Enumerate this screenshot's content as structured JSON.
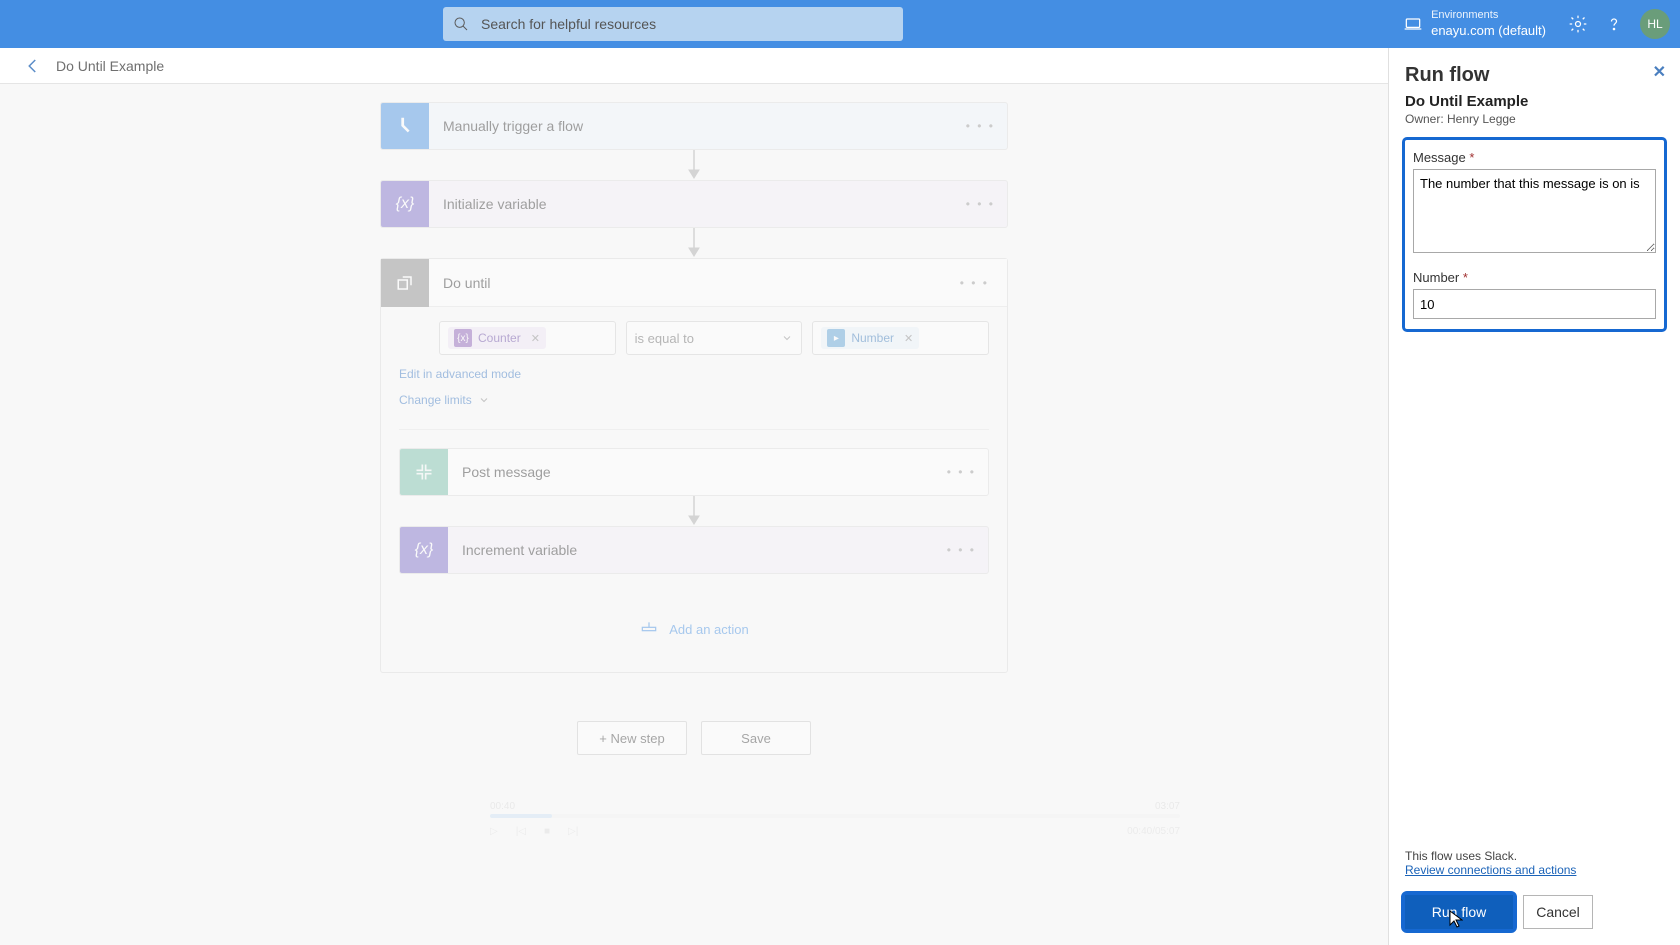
{
  "topbar": {
    "search_placeholder": "Search for helpful resources",
    "env_label": "Environments",
    "env_name": "enayu.com (default)",
    "avatar_initials": "HL"
  },
  "crumb": {
    "title": "Do Until Example"
  },
  "flow": {
    "trigger": {
      "label": "Manually trigger a flow"
    },
    "init_var": {
      "label": "Initialize variable"
    },
    "do_until": {
      "label": "Do until",
      "left_chip": "Counter",
      "operator": "is equal to",
      "right_chip": "Number",
      "advanced_link": "Edit in advanced mode",
      "limits_link": "Change limits",
      "post_message": {
        "label": "Post message"
      },
      "increment": {
        "label": "Increment variable"
      },
      "add_action": "Add an action"
    },
    "new_step": "+ New step",
    "save": "Save"
  },
  "panel": {
    "title": "Run flow",
    "subtitle": "Do Until Example",
    "owner": "Owner: Henry Legge",
    "message_label": "Message",
    "message_value": "The number that this message is on is",
    "number_label": "Number",
    "number_value": "10",
    "uses": "This flow uses Slack.",
    "review": "Review connections and actions",
    "run": "Run flow",
    "cancel": "Cancel"
  },
  "video": {
    "t_left": "00:40",
    "t_right": "03:07",
    "total": "00:40/05:07"
  }
}
